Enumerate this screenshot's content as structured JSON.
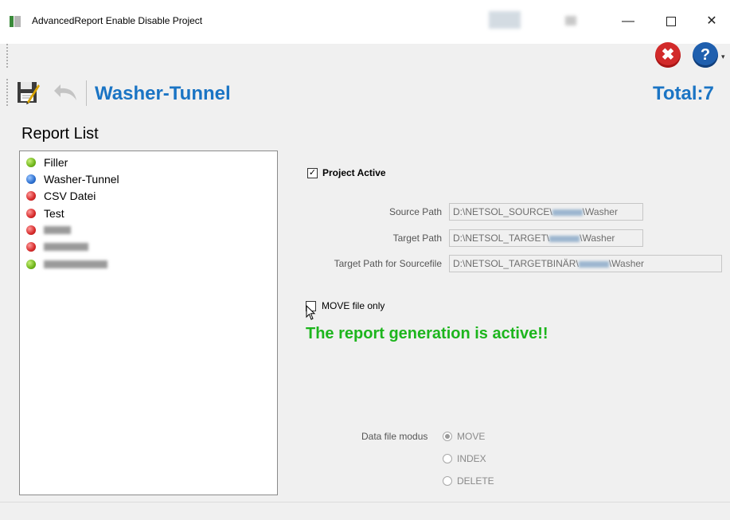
{
  "window": {
    "title": "AdvancedReport Enable Disable Project",
    "minimize_glyph": "—",
    "close_glyph": "✕"
  },
  "toolbar": {
    "close_icon": "close-circle-icon",
    "help_icon": "help-circle-icon",
    "close_glyph": "✖",
    "help_glyph": "?",
    "dropdown_glyph": "▾"
  },
  "header": {
    "project_name": "Washer-Tunnel",
    "total_label": "Total:7"
  },
  "report_list": {
    "label": "Report List",
    "items": [
      {
        "name": "Filler",
        "status": "green"
      },
      {
        "name": "Washer-Tunnel",
        "status": "blue"
      },
      {
        "name": "CSV Datei",
        "status": "red"
      },
      {
        "name": "Test",
        "status": "red"
      },
      {
        "name": "",
        "status": "red"
      },
      {
        "name": "",
        "status": "red"
      },
      {
        "name": "",
        "status": "green"
      }
    ]
  },
  "settings": {
    "project_active_label": "Project Active",
    "project_active_checked": true,
    "check_glyph": "✓",
    "source_path_label": "Source Path",
    "source_path_prefix": "D:\\NETSOL_SOURCE\\",
    "source_path_suffix": "\\Washer",
    "target_path_label": "Target Path",
    "target_path_prefix": "D:\\NETSOL_TARGET\\",
    "target_path_suffix": "\\Washer",
    "target_sourcefile_label": "Target Path for Sourcefile",
    "target_sourcefile_prefix": "D:\\NETSOL_TARGETBINÄR\\",
    "target_sourcefile_suffix": "\\Washer",
    "move_only_label": "MOVE file only",
    "move_only_checked": false,
    "status_message": "The report generation is active!!",
    "data_file_modus_label": "Data file modus",
    "modus_options": [
      "MOVE",
      "INDEX",
      "DELETE"
    ],
    "modus_selected": "MOVE"
  },
  "colors": {
    "accent_blue": "#1a74c4",
    "status_green": "#1db51d",
    "error_red": "#d22a2a"
  }
}
